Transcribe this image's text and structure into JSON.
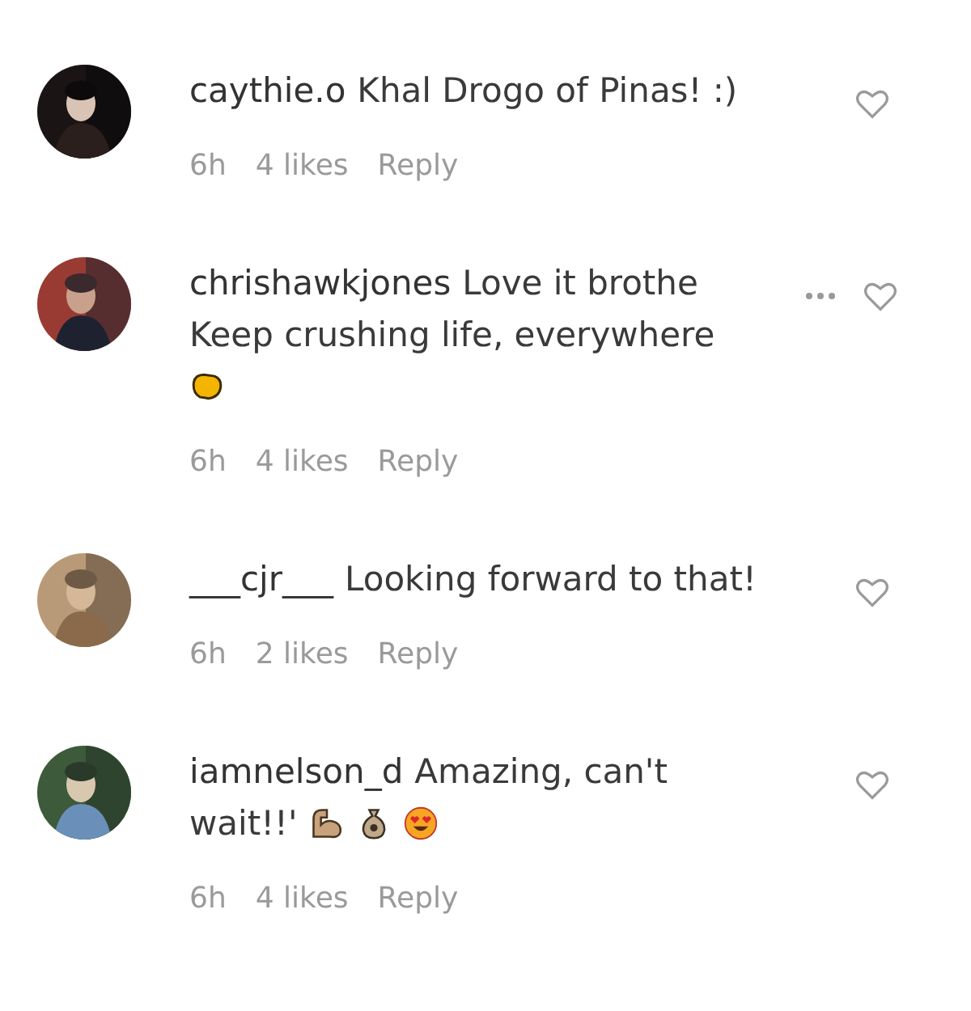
{
  "comments": [
    {
      "username": "caythie.o",
      "lines": [
        {
          "text": "Khal Drogo of Pinas! :)"
        }
      ],
      "more": false,
      "time": "6h",
      "likes": "4 likes",
      "reply": "Reply"
    },
    {
      "username": "chrishawkjones",
      "lines": [
        {
          "text": "Love it brothe"
        },
        {
          "text": "Keep crushing life, everywhere"
        },
        {
          "emojis": [
            {
              "kind": "fist"
            }
          ]
        }
      ],
      "more": true,
      "time": "6h",
      "likes": "4 likes",
      "reply": "Reply"
    },
    {
      "username": "___cjr___",
      "lines": [
        {
          "text": "Looking forward to that!"
        }
      ],
      "more": false,
      "time": "6h",
      "likes": "2 likes",
      "reply": "Reply"
    },
    {
      "username": "iamnelson_d",
      "lines": [
        {
          "text": "Amazing, can't"
        },
        {
          "text": "wait!!'",
          "emojis": [
            {
              "kind": "muscle"
            },
            {
              "kind": "bag"
            },
            {
              "kind": "heart-eyes"
            }
          ]
        }
      ],
      "more": false,
      "time": "6h",
      "likes": "4 likes",
      "reply": "Reply"
    }
  ]
}
